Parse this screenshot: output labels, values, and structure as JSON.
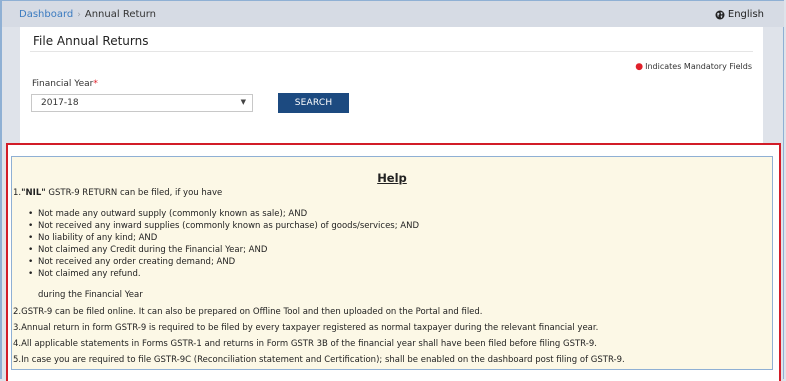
{
  "breadcrumb": {
    "home": "Dashboard",
    "separator": "›",
    "current": "Annual Return"
  },
  "language": {
    "icon": "globe-icon",
    "label": "English"
  },
  "card": {
    "title": "File Annual Returns",
    "mandatory_note": "Indicates Mandatory Fields",
    "financial_year_label": "Financial Year",
    "required_marker": "*",
    "financial_year_value": "2017-18",
    "search_button": "SEARCH"
  },
  "help": {
    "title": "Help",
    "item1_prefix": "1.",
    "item1_bold": "\"NIL\"",
    "item1_rest": " GSTR-9 RETURN can be filed, if you have",
    "bullets": [
      "Not made any outward supply (commonly known as sale); AND",
      "Not received any inward supplies (commonly known as purchase) of goods/services; AND",
      "No liability of any kind; AND",
      "Not claimed any Credit during the Financial Year; AND",
      "Not received any order creating demand; AND",
      "Not claimed any refund."
    ],
    "during": "during the Financial Year",
    "item2": "2.GSTR-9 can be filed online. It can also be prepared on Offline Tool and then uploaded on the Portal and filed.",
    "item3": "3.Annual return in form GSTR-9 is required to be filed by every taxpayer registered as normal taxpayer during the relevant financial year.",
    "item4": "4.All applicable statements in Forms GSTR-1 and returns in Form GSTR 3B of the financial year shall have been filed before filing GSTR-9.",
    "item5": "5.In case you are required to file GSTR-9C (Reconciliation statement and Certification); shall be enabled on the dashboard post filing of GSTR-9."
  },
  "colors": {
    "search_button": "#1c4a80",
    "highlight_border": "#d21c28",
    "help_background": "#fcf8e6",
    "link": "#3b7bc0"
  }
}
